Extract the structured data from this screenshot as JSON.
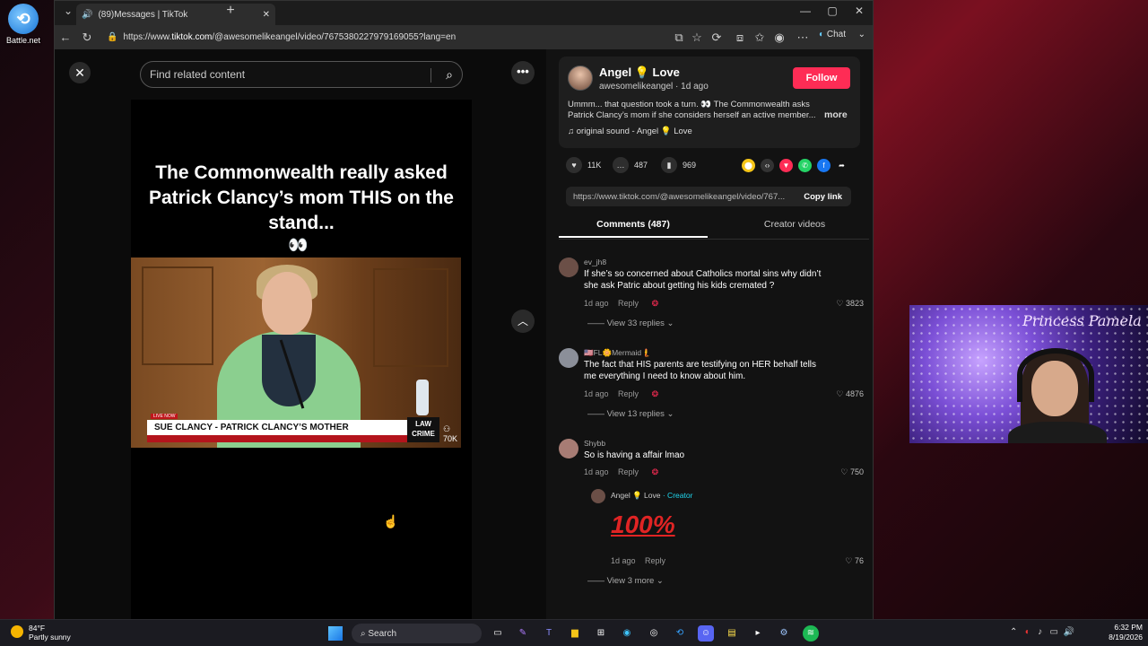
{
  "desktop": {
    "icon_label": "Battle.net",
    "icon_name": "battlenet-icon"
  },
  "browser": {
    "tab_title": "(89)Messages | TikTok",
    "url_prefix": "https://www.",
    "url_domain": "tiktok.com",
    "url_path": "/@awesomelikeangel/video/7675380227979169055?lang=en",
    "chat_label": "Chat"
  },
  "tiktok": {
    "search_placeholder": "Find related content",
    "video": {
      "caption": "The Commonwealth really asked Patrick Clancy’s mom THIS on the stand...",
      "eyes": "👀",
      "live_tag": "LIVE NOW",
      "lower_third": "SUE CLANCY - PATRICK CLANCY’S MOTHER",
      "network_logo": "LAW CRIME",
      "views": "70K"
    },
    "author": {
      "name": "Angel 💡 Love",
      "handle": "awesomelikeangel",
      "time": "1d ago",
      "follow_label": "Follow",
      "description": "Ummm... that question took a turn. 👀 The Commonwealth asks Patrick Clancy’s mom if she considers herself an active member...",
      "more_label": "more",
      "sound": "original sound - Angel 💡 Love"
    },
    "stats": {
      "likes": "11K",
      "comments": "487",
      "saves": "969"
    },
    "copy": {
      "link": "https://www.tiktok.com/@awesomelikeangel/video/767...",
      "label": "Copy link"
    },
    "tabs": {
      "comments": "Comments (487)",
      "creator": "Creator videos"
    },
    "comments": [
      {
        "user": "ev_jh8",
        "text": "If she’s so concerned about Catholics mortal sins why didn’t she ask Patric about getting his kids cremated ?",
        "time": "1d ago",
        "reply": "Reply",
        "likes": "3823",
        "replies": "View 33 replies"
      },
      {
        "user": "🇺🇸FL🌼Mermaid🧜",
        "text": "The fact that HIS parents are testifying on HER behalf tells me everything I need to know about him.",
        "time": "1d ago",
        "reply": "Reply",
        "likes": "4876",
        "replies": "View 13 replies"
      },
      {
        "user": "Shybb",
        "text": "So is having a affair lmao",
        "time": "1d ago",
        "reply": "Reply",
        "likes": "750"
      }
    ],
    "creator_reply": {
      "user": "Angel 💡 Love",
      "badge": "· Creator",
      "emoji": "100%",
      "time": "1d ago",
      "reply": "Reply",
      "likes": "76",
      "more": "View 3 more"
    }
  },
  "webcam": {
    "overlay_text": "Princess Pamela"
  },
  "taskbar": {
    "weather_temp": "84°F",
    "weather_desc": "Partly sunny",
    "search_label": "Search",
    "time": "6:32 PM",
    "date": "8/19/2026"
  }
}
